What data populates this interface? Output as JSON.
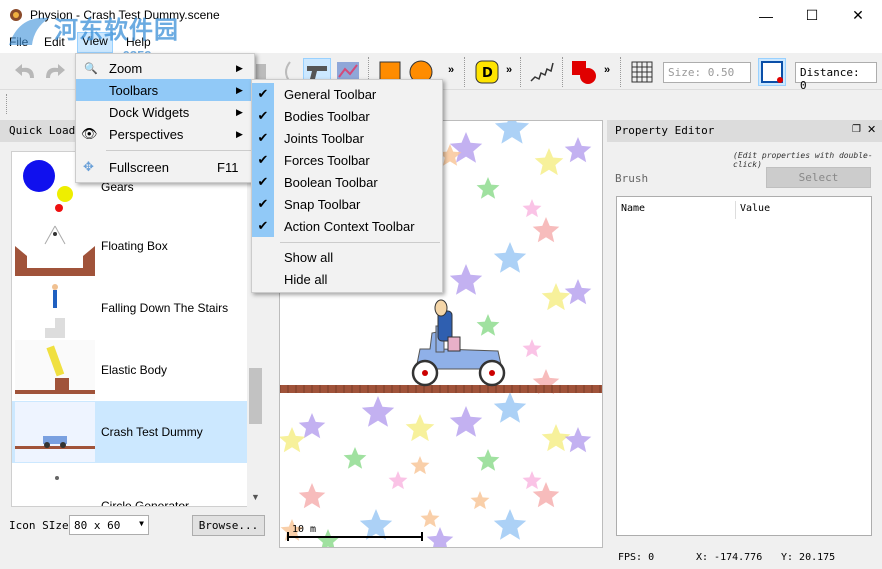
{
  "window": {
    "title": "Physion - Crash Test Dummy.scene",
    "minimize": "—",
    "maximize": "☐",
    "close": "✕"
  },
  "menubar": {
    "file": "File",
    "edit": "Edit",
    "view": "View",
    "help": "Help"
  },
  "watermark": {
    "line1": "河东软件园",
    "line2": "www.pc0359.cn"
  },
  "toolbar": {
    "size_value": "Size: 0.50",
    "distance_value": "Distance: 0"
  },
  "quick_load": {
    "title": "Quick Load",
    "items": [
      {
        "label": "Gears"
      },
      {
        "label": "Floating Box"
      },
      {
        "label": "Falling Down The Stairs"
      },
      {
        "label": "Elastic Body"
      },
      {
        "label": "Crash Test Dummy"
      },
      {
        "label": "Circle Generator"
      }
    ],
    "icon_size_label": "Icon SIze",
    "icon_size_value": "80 x 60",
    "browse_label": "Browse..."
  },
  "canvas": {
    "scale_label": "10 m"
  },
  "property_editor": {
    "title": "Property Editor",
    "hint": "(Edit properties with double-click)",
    "brush_label": "Brush",
    "select_label": "Select",
    "col_name": "Name",
    "col_value": "Value"
  },
  "status": {
    "fps": "FPS: 0",
    "x": "X: -174.776",
    "y": "Y: 20.175"
  },
  "view_menu": {
    "zoom": "Zoom",
    "toolbars": "Toolbars",
    "dock_widgets": "Dock Widgets",
    "perspectives": "Perspectives",
    "fullscreen": "Fullscreen",
    "fullscreen_shortcut": "F11"
  },
  "toolbars_submenu": {
    "items": [
      {
        "label": "General Toolbar"
      },
      {
        "label": "Bodies Toolbar"
      },
      {
        "label": "Joints Toolbar"
      },
      {
        "label": "Forces Toolbar"
      },
      {
        "label": "Boolean Toolbar"
      },
      {
        "label": "Snap Toolbar"
      },
      {
        "label": "Action Context Toolbar"
      }
    ],
    "show_all": "Show all",
    "hide_all": "Hide all"
  },
  "colors": {
    "highlight": "#91c9f7",
    "selection": "#cce8ff"
  }
}
